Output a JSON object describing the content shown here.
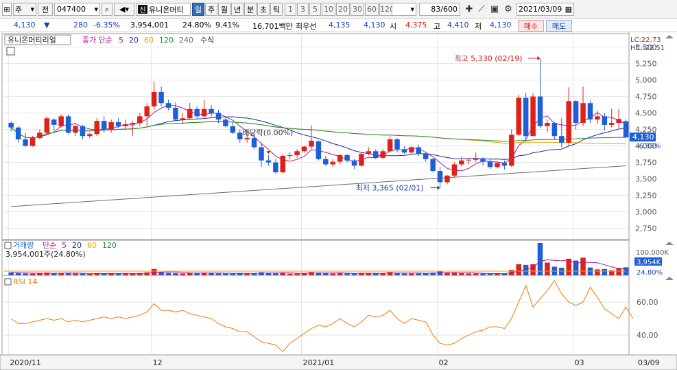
{
  "toolbar": {
    "market": "주",
    "range": "전",
    "code": "047400",
    "name": "유니온머티",
    "new_badge": "신",
    "periods": [
      "일",
      "주",
      "월",
      "년",
      "분",
      "초",
      "틱"
    ],
    "active_period": "일",
    "intervals": [
      "1",
      "3",
      "5",
      "10",
      "20",
      "30",
      "60",
      "120"
    ],
    "count": "83",
    "count_total": "/600",
    "date": "2021/03/09"
  },
  "quote": {
    "price": "4,130",
    "arrow": "▼",
    "change": "280",
    "change_pct": "-6.35%",
    "volume": "3,954,001",
    "volume_pct": "24.80%",
    "turnover": "9.41%",
    "amount": "16,701백만",
    "best_bid_label": "최우선",
    "best_bid": "4,135",
    "best_ask": "4,130",
    "open_label": "시",
    "open": "4,375",
    "high_label": "고",
    "high": "4,410",
    "low_label": "저",
    "low": "4,130",
    "buy_label": "매수",
    "sell_label": "매도"
  },
  "price_panel": {
    "title": "유니온머티리얼",
    "ma_label": "종가 단순",
    "ma_periods": [
      "5",
      "20",
      "60",
      "120",
      "240"
    ],
    "ma_colors": [
      "#b01a8e",
      "#1a2a9e",
      "#f0a300",
      "#1a8a3a",
      "#6b6b6b"
    ],
    "formula_label": "수식",
    "lc": "LC:22.73",
    "hc": "HC:-22.51",
    "y_ticks": [
      "5,500",
      "5,250",
      "5,000",
      "4,750",
      "4,500",
      "4,250",
      "4,000",
      "3,750",
      "3,500",
      "3,250",
      "3,000",
      "2,750"
    ],
    "current_price": "4,130",
    "current_pct": "-6.35%",
    "high_annotation": "최고 5,330 (02/19)",
    "low_annotation": "최저 3,365 (02/01)",
    "dividend_annotation": "배당락(0.00%)"
  },
  "volume_panel": {
    "title": "거래량",
    "ma_label": "단순",
    "ma_periods": [
      "5",
      "20",
      "60",
      "120"
    ],
    "value_text": "3,954,001주(24.80%)",
    "y_tick": "100,000K",
    "current": "3,954K",
    "current_pct": "24.80%"
  },
  "rsi_panel": {
    "title": "RSI 14",
    "y_ticks": [
      "60,00",
      "40,00"
    ]
  },
  "x_axis": {
    "labels": [
      "2020/11",
      "12",
      "2021/01",
      "02",
      "03"
    ],
    "right_label": "03/09"
  },
  "chart_data": {
    "type": "candlestick",
    "series": [
      {
        "name": "price",
        "ohlc": [
          [
            4350,
            4380,
            4220,
            4280
          ],
          [
            4280,
            4300,
            4050,
            4100
          ],
          [
            4100,
            4200,
            3980,
            4000
          ],
          [
            4000,
            4150,
            3990,
            4120
          ],
          [
            4120,
            4250,
            4100,
            4200
          ],
          [
            4200,
            4450,
            4180,
            4420
          ],
          [
            4400,
            4420,
            4230,
            4320
          ],
          [
            4300,
            4480,
            4280,
            4450
          ],
          [
            4450,
            4480,
            4180,
            4200
          ],
          [
            4200,
            4320,
            4150,
            4300
          ],
          [
            4300,
            4320,
            4100,
            4150
          ],
          [
            4150,
            4200,
            4120,
            4180
          ],
          [
            4180,
            4420,
            4150,
            4380
          ],
          [
            4380,
            4450,
            4200,
            4250
          ],
          [
            4250,
            4400,
            4200,
            4360
          ],
          [
            4360,
            4420,
            4270,
            4300
          ],
          [
            4300,
            4400,
            4250,
            4330
          ],
          [
            4330,
            4380,
            4150,
            4350
          ],
          [
            4350,
            4500,
            4300,
            4450
          ],
          [
            4450,
            4650,
            4300,
            4600
          ],
          [
            4600,
            4980,
            4550,
            4820
          ],
          [
            4820,
            4900,
            4600,
            4650
          ],
          [
            4650,
            4700,
            4540,
            4580
          ],
          [
            4580,
            4660,
            4380,
            4400
          ],
          [
            4400,
            4500,
            4330,
            4420
          ],
          [
            4420,
            4650,
            4400,
            4560
          ],
          [
            4560,
            4600,
            4420,
            4450
          ],
          [
            4450,
            4700,
            4410,
            4560
          ],
          [
            4560,
            4620,
            4450,
            4500
          ],
          [
            4500,
            4550,
            4350,
            4400
          ],
          [
            4400,
            4430,
            4280,
            4300
          ],
          [
            4300,
            4360,
            4180,
            4200
          ],
          [
            4200,
            4250,
            4050,
            4100
          ],
          [
            4100,
            4180,
            4050,
            4120
          ],
          [
            4120,
            4160,
            3950,
            3980
          ],
          [
            3980,
            4050,
            3680,
            3780
          ],
          [
            3780,
            3860,
            3700,
            3750
          ],
          [
            3750,
            3800,
            3580,
            3600
          ],
          [
            3600,
            3880,
            3580,
            3850
          ],
          [
            3850,
            3900,
            3800,
            3860
          ],
          [
            3860,
            3950,
            3820,
            3920
          ],
          [
            3920,
            4000,
            3900,
            3990
          ],
          [
            3990,
            4310,
            3950,
            4080
          ],
          [
            4070,
            4080,
            3780,
            3800
          ],
          [
            3800,
            3850,
            3700,
            3720
          ],
          [
            3720,
            3800,
            3680,
            3760
          ],
          [
            3760,
            3880,
            3720,
            3860
          ],
          [
            3860,
            3880,
            3750,
            3780
          ],
          [
            3780,
            3800,
            3650,
            3700
          ],
          [
            3700,
            3900,
            3680,
            3880
          ],
          [
            3880,
            3980,
            3860,
            3920
          ],
          [
            3920,
            3950,
            3800,
            3820
          ],
          [
            3820,
            3950,
            3800,
            3920
          ],
          [
            3920,
            4150,
            3900,
            4100
          ],
          [
            4100,
            4120,
            3900,
            3950
          ],
          [
            3950,
            4000,
            3880,
            3900
          ],
          [
            3900,
            4000,
            3880,
            3980
          ],
          [
            3980,
            4020,
            3850,
            3880
          ],
          [
            3880,
            3900,
            3760,
            3800
          ],
          [
            3800,
            3820,
            3600,
            3620
          ],
          [
            3620,
            3680,
            3365,
            3450
          ],
          [
            3450,
            3560,
            3420,
            3550
          ],
          [
            3550,
            3750,
            3520,
            3720
          ],
          [
            3720,
            3840,
            3690,
            3780
          ],
          [
            3780,
            3820,
            3720,
            3790
          ],
          [
            3790,
            3900,
            3760,
            3810
          ],
          [
            3810,
            3830,
            3700,
            3760
          ],
          [
            3760,
            3800,
            3650,
            3680
          ],
          [
            3680,
            3760,
            3660,
            3740
          ],
          [
            3740,
            3780,
            3640,
            3700
          ],
          [
            3700,
            4250,
            3680,
            4170
          ],
          [
            4170,
            4780,
            4150,
            4730
          ],
          [
            4730,
            4810,
            4060,
            4150
          ],
          [
            4150,
            4800,
            4150,
            4750
          ],
          [
            4750,
            5330,
            4270,
            4300
          ],
          [
            4300,
            4400,
            4210,
            4350
          ],
          [
            4350,
            4360,
            4100,
            4150
          ],
          [
            4150,
            4420,
            3980,
            4050
          ],
          [
            4050,
            4890,
            4000,
            4680
          ],
          [
            4680,
            4700,
            4250,
            4350
          ],
          [
            4350,
            4900,
            4300,
            4650
          ],
          [
            4650,
            4690,
            4350,
            4400
          ],
          [
            4400,
            4530,
            4330,
            4450
          ],
          [
            4450,
            4500,
            4240,
            4320
          ],
          [
            4320,
            4560,
            4280,
            4350
          ],
          [
            4350,
            4560,
            4280,
            4410
          ],
          [
            4375,
            4410,
            4130,
            4130
          ]
        ]
      },
      {
        "name": "volume",
        "values": [
          1.4,
          1.1,
          0.9,
          0.8,
          0.9,
          1.3,
          1.0,
          1.1,
          1.0,
          0.9,
          0.8,
          0.7,
          1.0,
          0.9,
          1.0,
          0.8,
          0.9,
          0.8,
          1.0,
          1.4,
          3.1,
          1.5,
          1.1,
          1.0,
          0.9,
          1.2,
          1.0,
          1.3,
          1.0,
          0.9,
          0.8,
          0.8,
          1.1,
          0.9,
          1.0,
          1.5,
          1.1,
          1.0,
          1.4,
          0.8,
          0.8,
          0.9,
          1.6,
          1.3,
          1.0,
          0.9,
          1.1,
          0.9,
          0.8,
          1.2,
          1.0,
          0.9,
          1.0,
          1.6,
          1.1,
          0.9,
          0.9,
          0.9,
          1.0,
          1.3,
          1.9,
          1.2,
          1.3,
          1.0,
          0.9,
          0.9,
          0.8,
          0.8,
          0.8,
          0.8,
          2.6,
          5.4,
          5.1,
          5.4,
          15.8,
          6.2,
          4.2,
          3.7,
          8.1,
          7.2,
          8.6,
          3.8,
          2.9,
          3.1,
          2.4,
          3.6,
          3.9
        ]
      },
      {
        "name": "RSI 14",
        "values": [
          50,
          47,
          47,
          48,
          49,
          50,
          49,
          50,
          48,
          49,
          48,
          49,
          50,
          51,
          50,
          51,
          50,
          51,
          52,
          54,
          59,
          55,
          55,
          54,
          55,
          53,
          52,
          51,
          50,
          47,
          45,
          44,
          42,
          42,
          39,
          36,
          35,
          34,
          30,
          35,
          38,
          41,
          44,
          46,
          45,
          47,
          50,
          47,
          45,
          48,
          52,
          51,
          52,
          55,
          50,
          47,
          50,
          49,
          48,
          40,
          35,
          34,
          35,
          38,
          40,
          42,
          43,
          45,
          45,
          44,
          50,
          60,
          70,
          57,
          62,
          67,
          73,
          65,
          60,
          58,
          60,
          69,
          63,
          56,
          53,
          50,
          57,
          50
        ]
      }
    ],
    "ylim": [
      2600,
      5600
    ],
    "rsi_ylim": [
      28,
      75
    ]
  }
}
